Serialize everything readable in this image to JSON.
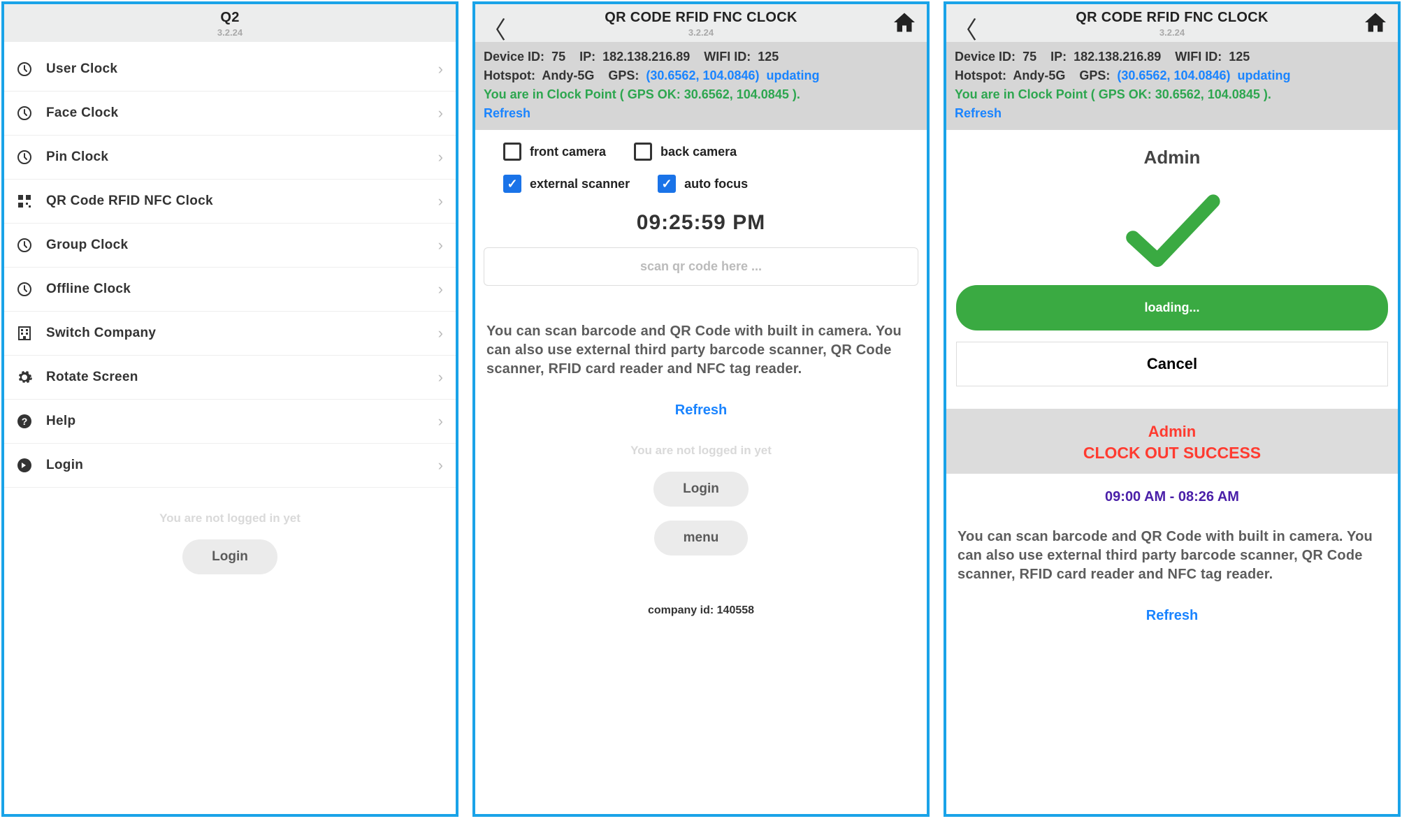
{
  "panel1": {
    "title": "Q2",
    "version": "3.2.24",
    "items": [
      {
        "icon": "clock",
        "label": "User Clock"
      },
      {
        "icon": "clock",
        "label": "Face Clock"
      },
      {
        "icon": "clock",
        "label": "Pin Clock"
      },
      {
        "icon": "qr",
        "label": "QR Code RFID NFC Clock"
      },
      {
        "icon": "clock",
        "label": "Group Clock"
      },
      {
        "icon": "clock",
        "label": "Offline Clock"
      },
      {
        "icon": "building",
        "label": "Switch Company"
      },
      {
        "icon": "gear",
        "label": "Rotate Screen"
      },
      {
        "icon": "help",
        "label": "Help"
      },
      {
        "icon": "login",
        "label": "Login"
      }
    ],
    "not_logged": "You are not logged in yet",
    "login_btn": "Login"
  },
  "panel2": {
    "title": "QR CODE RFID FNC CLOCK",
    "version": "3.2.24",
    "dev_label": "Device ID:",
    "dev_id": "75",
    "ip_label": "IP:",
    "ip": "182.138.216.89",
    "wifi_label": "WIFI ID:",
    "wifi_id": "125",
    "hotspot_label": "Hotspot:",
    "hotspot": "Andy-5G",
    "gps_label": "GPS:",
    "gps": "(30.6562, 104.0846)",
    "updating": "updating",
    "clockpoint": "You are in Clock Point ( GPS OK: 30.6562, 104.0845 ).",
    "refresh": "Refresh",
    "chk_front": "front camera",
    "chk_back": "back camera",
    "chk_ext": "external scanner",
    "chk_auto": "auto focus",
    "time": "09:25:59 PM",
    "scan_placeholder": "scan qr code here ...",
    "info": "You can scan barcode and QR Code with built in camera. You can also use external third party barcode scanner, QR Code scanner, RFID card reader and NFC tag reader.",
    "refresh2": "Refresh",
    "not_logged": "You are not logged in yet",
    "login_btn": "Login",
    "menu_btn": "menu",
    "company_id_label": "company id:",
    "company_id": "140558"
  },
  "panel3": {
    "title": "QR CODE RFID FNC CLOCK",
    "version": "3.2.24",
    "admin": "Admin",
    "loading": "loading...",
    "cancel": "Cancel",
    "res_l1": "Admin",
    "res_l2": "CLOCK OUT SUCCESS",
    "time_range": "09:00 AM - 08:26 AM",
    "info": "You can scan barcode and QR Code with built in camera. You can also use external third party barcode scanner, QR Code scanner, RFID card reader and NFC tag reader.",
    "refresh": "Refresh"
  }
}
